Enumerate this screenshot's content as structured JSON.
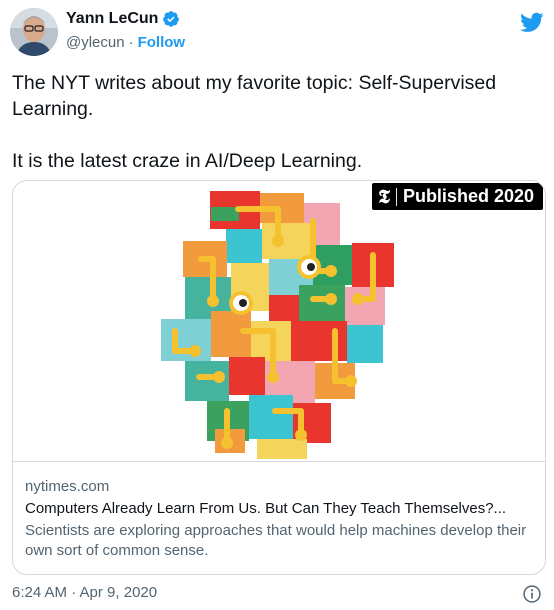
{
  "author": {
    "display_name": "Yann LeCun",
    "handle": "@ylecun",
    "separator": "·",
    "follow_label": "Follow"
  },
  "tweet": {
    "paragraphs": [
      "The NYT writes about my favorite topic: Self-Supervised Learning.",
      "It is the latest craze in AI/Deep Learning."
    ],
    "timestamp": "6:24 AM · Apr 9, 2020"
  },
  "card": {
    "badge_mark": "𝕿",
    "badge_text": "Published 2020",
    "domain": "nytimes.com",
    "title": "Computers Already Learn From Us. But Can They Teach Themselves?...",
    "description": "Scientists are exploring approaches that would help machines develop their own sort of common sense."
  },
  "icons": {
    "avatar": "avatar",
    "verified": "verified-badge-icon",
    "brand": "twitter-bird-icon",
    "info": "info-icon"
  },
  "colors": {
    "accent": "#1d9bf0",
    "text": "#0f1419",
    "secondary": "#536471",
    "border": "#cfd9de"
  }
}
